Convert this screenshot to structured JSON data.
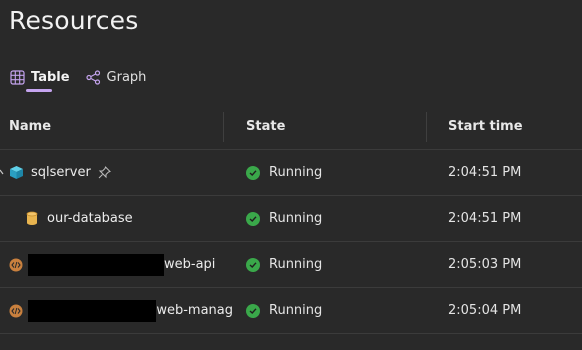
{
  "page": {
    "title": "Resources"
  },
  "tabs": [
    {
      "label": "Table",
      "icon": "table-icon",
      "active": true
    },
    {
      "label": "Graph",
      "icon": "graph-icon",
      "active": false
    }
  ],
  "columns": {
    "name": "Name",
    "state": "State",
    "start_time": "Start time"
  },
  "colors": {
    "accent": "#c5a4ef",
    "running": "#3aa84a",
    "background": "#292929"
  },
  "rows": [
    {
      "name": "sqlserver",
      "icon": "container-icon",
      "pinned": true,
      "state": "Running",
      "start_time": "2:04:51 PM"
    },
    {
      "name": "our-database",
      "icon": "database-icon",
      "pinned": false,
      "state": "Running",
      "start_time": "2:04:51 PM"
    },
    {
      "name": "web-api",
      "icon": "project-icon",
      "redacted_prefix": true,
      "state": "Running",
      "start_time": "2:05:03 PM"
    },
    {
      "name": "web-manag",
      "icon": "project-icon",
      "redacted_prefix": true,
      "state": "Running",
      "start_time": "2:05:04 PM"
    }
  ]
}
